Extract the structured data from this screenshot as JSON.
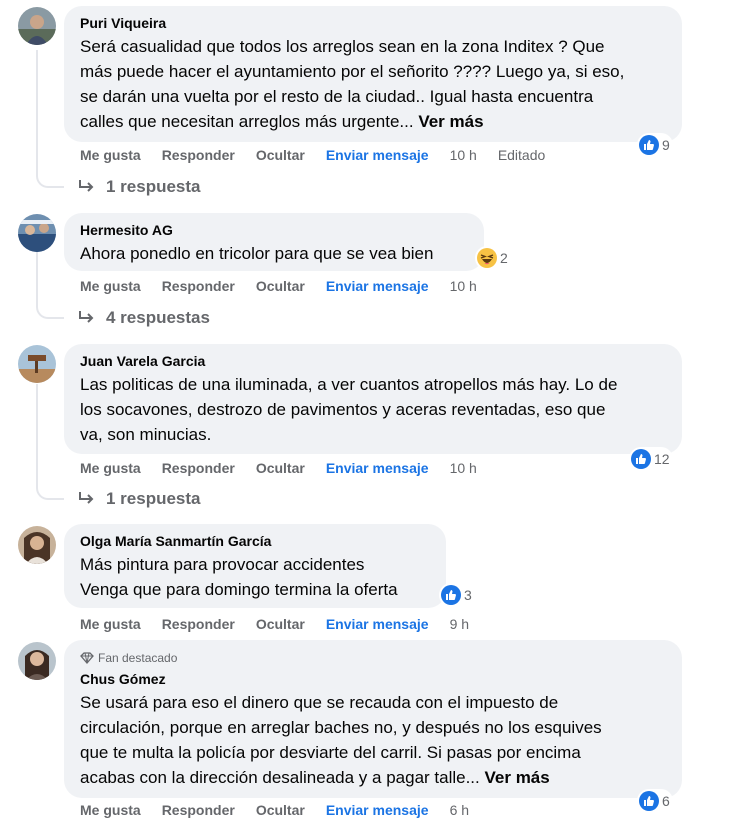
{
  "colors": {
    "bubble": "#f0f2f5",
    "link_blue": "#1b74e4",
    "secondary": "#65676b",
    "like_blue": "#1b74e4"
  },
  "actions": {
    "like": "Me gusta",
    "reply": "Responder",
    "hide": "Ocultar",
    "message": "Enviar mensaje"
  },
  "comments": [
    {
      "author": "Puri Viqueira",
      "lines": [
        "Será casualidad que todos los arreglos sean en la zona Inditex ? Que",
        "más puede hacer el ayuntamiento por el señorito ???? Luego ya, si eso,",
        "se darán una vuelta por el resto de la ciudad.. Igual hasta encuentra",
        "calles que necesitan arreglos más urgente..."
      ],
      "see_more": "Ver más",
      "reaction_icon": "like-icon",
      "reaction_count": "9",
      "time": "10 h",
      "edited": "Editado",
      "replies": "1 respuesta"
    },
    {
      "author": "Hermesito AG",
      "lines": [
        "Ahora ponedlo en tricolor para que se vea bien"
      ],
      "reaction_icon": "haha-icon",
      "reaction_count": "2",
      "time": "10 h",
      "replies": "4 respuestas"
    },
    {
      "author": "Juan Varela Garcia",
      "lines": [
        "Las politicas de una iluminada, a ver cuantos atropellos más hay. Lo de",
        "los socavones, destrozo de pavimentos y aceras reventadas, eso que",
        "va, son minucias."
      ],
      "reaction_icon": "like-icon",
      "reaction_count": "12",
      "time": "10 h",
      "replies": "1 respuesta"
    },
    {
      "author": "Olga María Sanmartín García",
      "lines": [
        "Más pintura para provocar accidentes",
        "Venga que para domingo termina la oferta"
      ],
      "reaction_icon": "like-icon",
      "reaction_count": "3",
      "time": "9 h"
    },
    {
      "badge": "Fan destacado",
      "badge_icon": "diamond-icon",
      "author": "Chus Gómez",
      "lines": [
        "Se usará para eso el dinero que se recauda con el impuesto de",
        "circulación, porque en arreglar baches no, y después no los esquives",
        "que te multa la policía por desviarte del carril. Si pasas por encima",
        "acabas con la dirección desalineada y a pagar talle..."
      ],
      "see_more": "Ver más",
      "reaction_icon": "like-icon",
      "reaction_count": "6",
      "time": "6 h"
    }
  ]
}
